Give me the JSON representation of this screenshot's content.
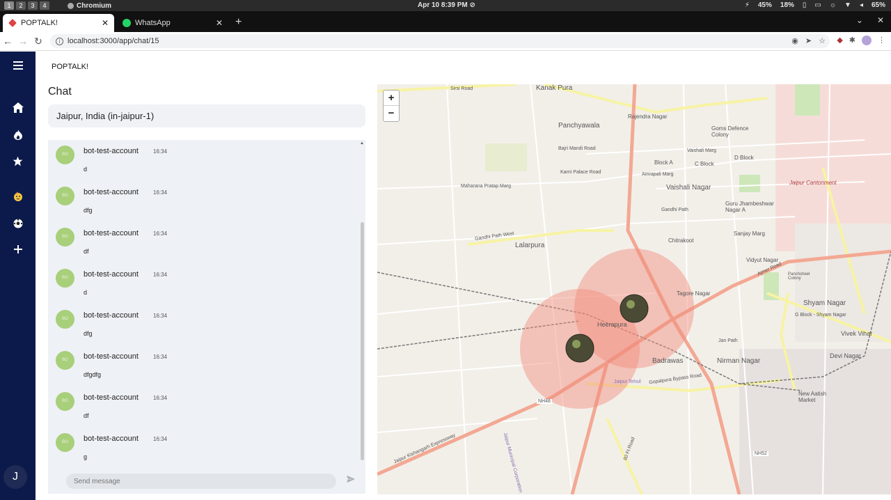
{
  "os": {
    "workspaces": [
      "1",
      "2",
      "3",
      "4"
    ],
    "active_app": "Chromium",
    "clock": "Apr 10  8:39 PM",
    "status": [
      "45%",
      "18%",
      "65%"
    ]
  },
  "browser": {
    "tabs": [
      {
        "label": "POPTALK!",
        "active": true
      },
      {
        "label": "WhatsApp",
        "active": false
      }
    ],
    "url": "localhost:3000/app/chat/15"
  },
  "sidebar": {
    "items": [
      {
        "icon": "home-icon"
      },
      {
        "icon": "fire-icon"
      },
      {
        "icon": "star-icon"
      },
      {
        "icon": "party-face-icon"
      },
      {
        "icon": "soccer-ball-icon"
      },
      {
        "icon": "plus-icon"
      }
    ],
    "user_initial": "J"
  },
  "app": {
    "brand": "POPTALK!",
    "heading": "Chat",
    "location": "Jaipur, India (in-jaipur-1)"
  },
  "messages": [
    {
      "avatar": "BO",
      "author": "bot-test-account",
      "time": "16:34",
      "text": "d"
    },
    {
      "avatar": "BO",
      "author": "bot-test-account",
      "time": "16:34",
      "text": "dfg"
    },
    {
      "avatar": "BO",
      "author": "bot-test-account",
      "time": "16:34",
      "text": "df"
    },
    {
      "avatar": "BO",
      "author": "bot-test-account",
      "time": "16:34",
      "text": "d"
    },
    {
      "avatar": "BO",
      "author": "bot-test-account",
      "time": "16:34",
      "text": "dfg"
    },
    {
      "avatar": "BO",
      "author": "bot-test-account",
      "time": "16:34",
      "text": "dfgdfg"
    },
    {
      "avatar": "BO",
      "author": "bot-test-account",
      "time": "16:34",
      "text": "df"
    },
    {
      "avatar": "BO",
      "author": "bot-test-account",
      "time": "16:34",
      "text": "g"
    }
  ],
  "composer": {
    "placeholder": "Send message"
  },
  "map": {
    "zoom_in": "+",
    "zoom_out": "−",
    "labels": [
      "Kanak Pura",
      "Sirsi Road",
      "Panchyawala",
      "Rajendra Nagar",
      "Goms Defence Colony",
      "Bajri Mandi Road",
      "Vaishali Marg",
      "D Block",
      "Block A",
      "C Block",
      "Karni Palace Road",
      "Amrapali Marg",
      "Jaipur Cantonment",
      "Maharana Pratap Marg",
      "Vaishali Nagar",
      "Guru Jhambeshwar Nagar A",
      "Gandhi Path",
      "Gandhi Path West",
      "Lalarpura",
      "Chitrakoot",
      "Sanjay Marg",
      "Vidyut Nagar",
      "Ajmer Road",
      "Tagore Nagar",
      "Shyam Nagar",
      "Heerapura",
      "G Block - Shyam Nagar",
      "Vivek Vihar",
      "Badrawas",
      "Nirman Nagar",
      "Devi Nagar",
      "Jaipur Kishangarh Expressway",
      "NH48",
      "Gopalpura Bypass Road",
      "New Aatish Market",
      "NH52",
      "80 Ft Road",
      "Jaipur Tehsil",
      "Panchsheel Colony",
      "Jan Path",
      "Jaipur Municipal Corporation"
    ]
  }
}
